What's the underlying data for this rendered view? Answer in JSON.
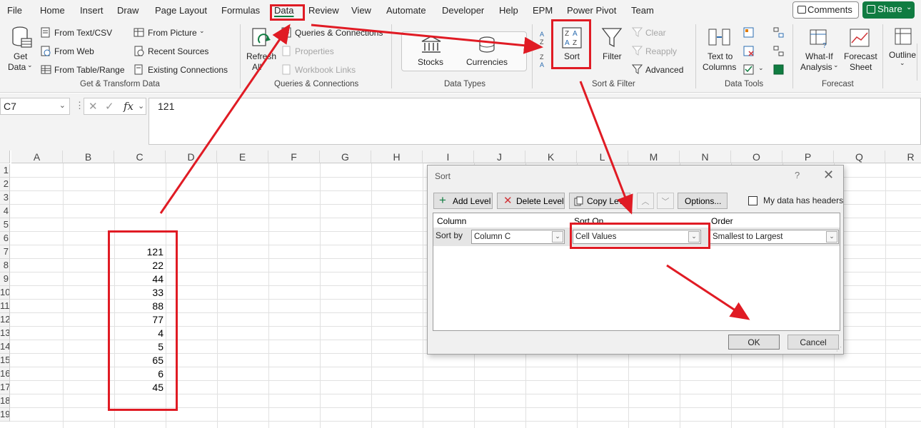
{
  "menu": {
    "items": [
      "File",
      "Home",
      "Insert",
      "Draw",
      "Page Layout",
      "Formulas",
      "Data",
      "Review",
      "View",
      "Automate",
      "Developer",
      "Help",
      "EPM",
      "Power Pivot",
      "Team"
    ],
    "active": "Data",
    "comments": "Comments",
    "share": "Share"
  },
  "ribbon": {
    "get_data": {
      "line1": "Get",
      "line2": "Data"
    },
    "get_transform": {
      "from_text_csv": "From Text/CSV",
      "from_web": "From Web",
      "from_table_range": "From Table/Range",
      "from_picture": "From Picture",
      "recent_sources": "Recent Sources",
      "existing_connections": "Existing Connections",
      "label": "Get & Transform Data"
    },
    "queries": {
      "refresh_line1": "Refresh",
      "refresh_line2": "All",
      "queries_connections": "Queries & Connections",
      "properties": "Properties",
      "workbook_links": "Workbook Links",
      "label": "Queries & Connections"
    },
    "data_types": {
      "stocks": "Stocks",
      "currencies": "Currencies",
      "label": "Data Types"
    },
    "sort_filter": {
      "sort": "Sort",
      "filter": "Filter",
      "clear": "Clear",
      "reapply": "Reapply",
      "advanced": "Advanced",
      "label": "Sort & Filter"
    },
    "data_tools": {
      "text_to_line1": "Text to",
      "text_to_line2": "Columns",
      "label": "Data Tools"
    },
    "forecast": {
      "what_if_line1": "What-If",
      "what_if_line2": "Analysis",
      "forecast_line1": "Forecast",
      "forecast_line2": "Sheet",
      "label": "Forecast"
    },
    "outline": {
      "label": "Outline"
    }
  },
  "formula_bar": {
    "name_box": "C7",
    "fx": "fx",
    "value": "121"
  },
  "sheet": {
    "columns": [
      "A",
      "B",
      "C",
      "D",
      "E",
      "F",
      "G",
      "H",
      "I",
      "J",
      "K",
      "L",
      "M",
      "N",
      "O",
      "P",
      "Q",
      "R"
    ],
    "row_numbers": [
      "1",
      "2",
      "3",
      "4",
      "5",
      "6",
      "7",
      "8",
      "9",
      "10",
      "11",
      "12",
      "13",
      "14",
      "15",
      "16",
      "17",
      "18",
      "19"
    ],
    "column_c_values": [
      "121",
      "22",
      "44",
      "33",
      "88",
      "77",
      "4",
      "5",
      "65",
      "6",
      "45"
    ]
  },
  "dialog": {
    "title": "Sort",
    "help": "?",
    "close": "✕",
    "add_level": "Add Level",
    "delete_level": "Delete Level",
    "copy_level": "Copy Level",
    "options": "Options...",
    "my_data_has_headers": "My data has headers",
    "headers": {
      "column": "Column",
      "sort_on": "Sort On",
      "order": "Order"
    },
    "sort_by": "Sort by",
    "column_value": "Column C",
    "sort_on_value": "Cell Values",
    "order_value": "Smallest to Largest",
    "ok": "OK",
    "cancel": "Cancel"
  },
  "annotation_color": "#e01b24"
}
